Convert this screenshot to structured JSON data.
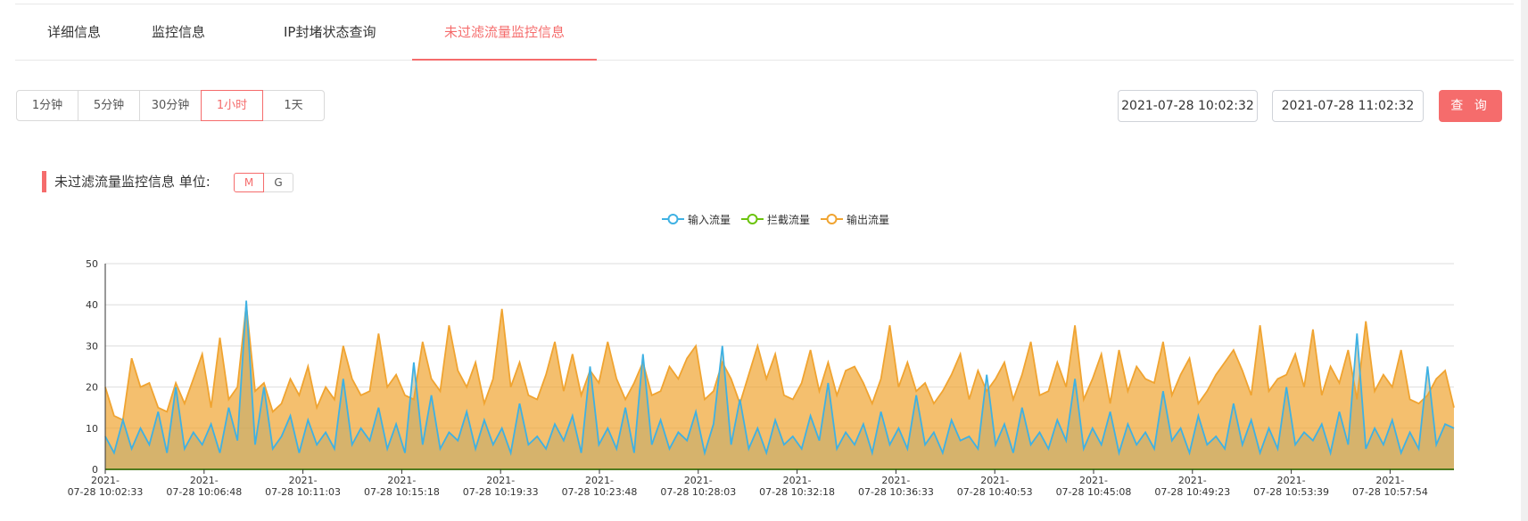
{
  "tabs": [
    {
      "label": "详细信息"
    },
    {
      "label": "监控信息"
    },
    {
      "label": "IP封堵状态查询"
    },
    {
      "label": "未过滤流量监控信息"
    }
  ],
  "active_tab": 3,
  "ranges": [
    "1分钟",
    "5分钟",
    "30分钟",
    "1小时",
    "1天"
  ],
  "active_range": 3,
  "date_start": "2021-07-28 10:02:32",
  "date_end": "2021-07-28 11:02:32",
  "query_label": "查 询",
  "section": {
    "title": "未过滤流量监控信息 单位:",
    "units": [
      "M",
      "G"
    ],
    "active_unit": 0
  },
  "colors": {
    "accent": "#f56c6c",
    "input": "#3fb1e3",
    "blocked": "#6bc30d",
    "output": "#f0a431"
  },
  "chart_data": {
    "type": "area",
    "series": [
      {
        "name": "输入流量",
        "color": "#3fb1e3"
      },
      {
        "name": "拦截流量",
        "color": "#6bc30d"
      },
      {
        "name": "输出流量",
        "color": "#f0a431"
      }
    ],
    "ylim": [
      0,
      50
    ],
    "yticks": [
      "0",
      "10",
      "20",
      "30",
      "40",
      "50"
    ],
    "x_ticks": [
      {
        "date": "2021-",
        "time": "07-28 10:02:33"
      },
      {
        "date": "2021-",
        "time": "07-28 10:06:48"
      },
      {
        "date": "2021-",
        "time": "07-28 10:11:03"
      },
      {
        "date": "2021-",
        "time": "07-28 10:15:18"
      },
      {
        "date": "2021-",
        "time": "07-28 10:19:33"
      },
      {
        "date": "2021-",
        "time": "07-28 10:23:48"
      },
      {
        "date": "2021-",
        "time": "07-28 10:28:03"
      },
      {
        "date": "2021-",
        "time": "07-28 10:32:18"
      },
      {
        "date": "2021-",
        "time": "07-28 10:36:33"
      },
      {
        "date": "2021-",
        "time": "07-28 10:40:53"
      },
      {
        "date": "2021-",
        "time": "07-28 10:45:08"
      },
      {
        "date": "2021-",
        "time": "07-28 10:49:23"
      },
      {
        "date": "2021-",
        "time": "07-28 10:53:39"
      },
      {
        "date": "2021-",
        "time": "07-28 10:57:54"
      }
    ],
    "sample_values": {
      "output": [
        20,
        13,
        12,
        27,
        20,
        21,
        15,
        14,
        21,
        16,
        22,
        28,
        15,
        32,
        17,
        20,
        40,
        19,
        21,
        14,
        16,
        22,
        18,
        25,
        15,
        20,
        17,
        30,
        22,
        18,
        19,
        33,
        20,
        23,
        18,
        17,
        31,
        22,
        19,
        35,
        24,
        20,
        26,
        16,
        22,
        39,
        20,
        26,
        18,
        17,
        23,
        31,
        19,
        28,
        18,
        24,
        21,
        31,
        22,
        17,
        21,
        26,
        18,
        19,
        25,
        22,
        27,
        30,
        17,
        19,
        26,
        22,
        16,
        23,
        30,
        22,
        28,
        18,
        17,
        21,
        29,
        19,
        26,
        18,
        24,
        25,
        21,
        16,
        22,
        35,
        20,
        26,
        19,
        21,
        16,
        19,
        23,
        28,
        17,
        24,
        19,
        22,
        26,
        17,
        23,
        31,
        18,
        19,
        26,
        20,
        35,
        17,
        22,
        28,
        16,
        29,
        19,
        25,
        22,
        21,
        31,
        18,
        23,
        27,
        16,
        19,
        23,
        26,
        29,
        24,
        18,
        35,
        19,
        22,
        23,
        28,
        20,
        34,
        18,
        25,
        21,
        29,
        17,
        36,
        19,
        23,
        20,
        29,
        17,
        16,
        18,
        22,
        24,
        15
      ],
      "input": [
        8,
        4,
        12,
        5,
        10,
        6,
        14,
        4,
        20,
        5,
        9,
        6,
        11,
        4,
        15,
        7,
        41,
        6,
        20,
        5,
        8,
        13,
        4,
        12,
        6,
        9,
        5,
        22,
        6,
        10,
        7,
        15,
        5,
        11,
        4,
        26,
        6,
        18,
        5,
        9,
        7,
        14,
        5,
        12,
        6,
        10,
        4,
        16,
        6,
        8,
        5,
        11,
        7,
        13,
        4,
        25,
        6,
        10,
        5,
        15,
        4,
        28,
        6,
        12,
        5,
        9,
        7,
        14,
        4,
        11,
        30,
        6,
        17,
        5,
        10,
        4,
        12,
        6,
        8,
        5,
        13,
        7,
        21,
        5,
        9,
        6,
        11,
        4,
        14,
        6,
        10,
        5,
        18,
        6,
        9,
        4,
        12,
        7,
        8,
        5,
        23,
        6,
        11,
        4,
        15,
        6,
        9,
        5,
        12,
        7,
        22,
        5,
        10,
        6,
        14,
        4,
        11,
        6,
        9,
        5,
        19,
        7,
        10,
        4,
        13,
        6,
        8,
        5,
        16,
        6,
        12,
        4,
        10,
        5,
        20,
        6,
        9,
        7,
        11,
        4,
        14,
        6,
        33,
        5,
        10,
        6,
        12,
        4,
        9,
        5,
        25,
        6,
        11,
        10
      ]
    }
  }
}
